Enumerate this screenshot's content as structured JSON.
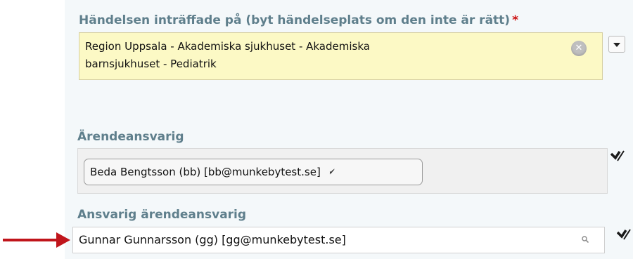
{
  "location": {
    "label": "Händelsen inträffade på (byt händelseplats om den inte är rätt)",
    "required_marker": "*",
    "value_line1": "Region Uppsala - Akademiska sjukhuset - Akademiska",
    "value_line2": "barnsjukhuset - Pediatrik",
    "clear_icon": "clear-icon",
    "dropdown_icon": "chevron-down-icon"
  },
  "case_owner": {
    "label": "Ärendeansvarig",
    "chip_text": "Beda Bengtsson (bb) [bb@munkebytest.se]",
    "select_icon": "select-user-icon"
  },
  "responsible_owner": {
    "label": "Ansvarig ärendeansvarig",
    "value": "Gunnar Gunnarsson (gg) [gg@munkebytest.se]",
    "search_icon": "search-icon",
    "select_icon": "select-user-icon"
  },
  "annotation": {
    "arrow_color": "#c0151b"
  },
  "colors": {
    "label_color": "#5f7f8c",
    "required_color": "#cc1111",
    "highlight_bg": "#fcf9c5"
  }
}
